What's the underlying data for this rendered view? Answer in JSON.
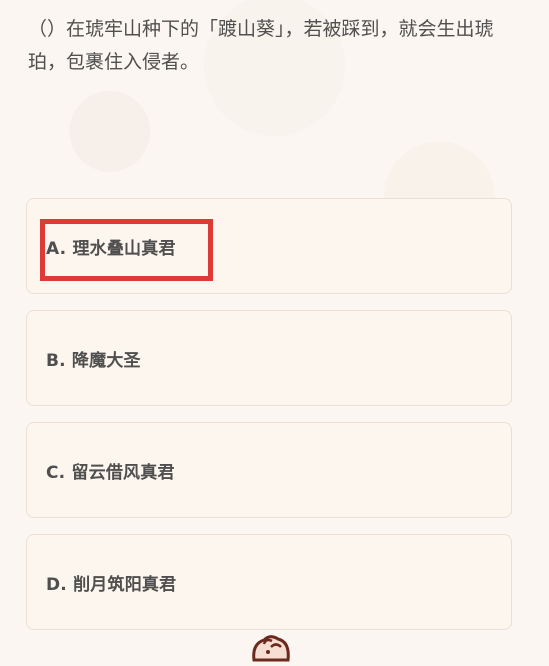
{
  "question": {
    "text": "（）在琥牢山种下的「踱山葵」，若被踩到，就会生出琥珀，包裹住入侵者。"
  },
  "options": [
    {
      "label": "A. 理水叠山真君"
    },
    {
      "label": "B. 降魔大圣"
    },
    {
      "label": "C. 留云借风真君"
    },
    {
      "label": "D. 削月筑阳真君"
    }
  ],
  "highlight": {
    "color": "#e03a36",
    "target_option_index": 0
  },
  "icons": {
    "mascot": "mascot-icon"
  },
  "colors": {
    "background": "#fbf6f1",
    "option_bg": "#fdf6ef",
    "option_border": "#eadfd3",
    "text": "#4f4f4f"
  }
}
